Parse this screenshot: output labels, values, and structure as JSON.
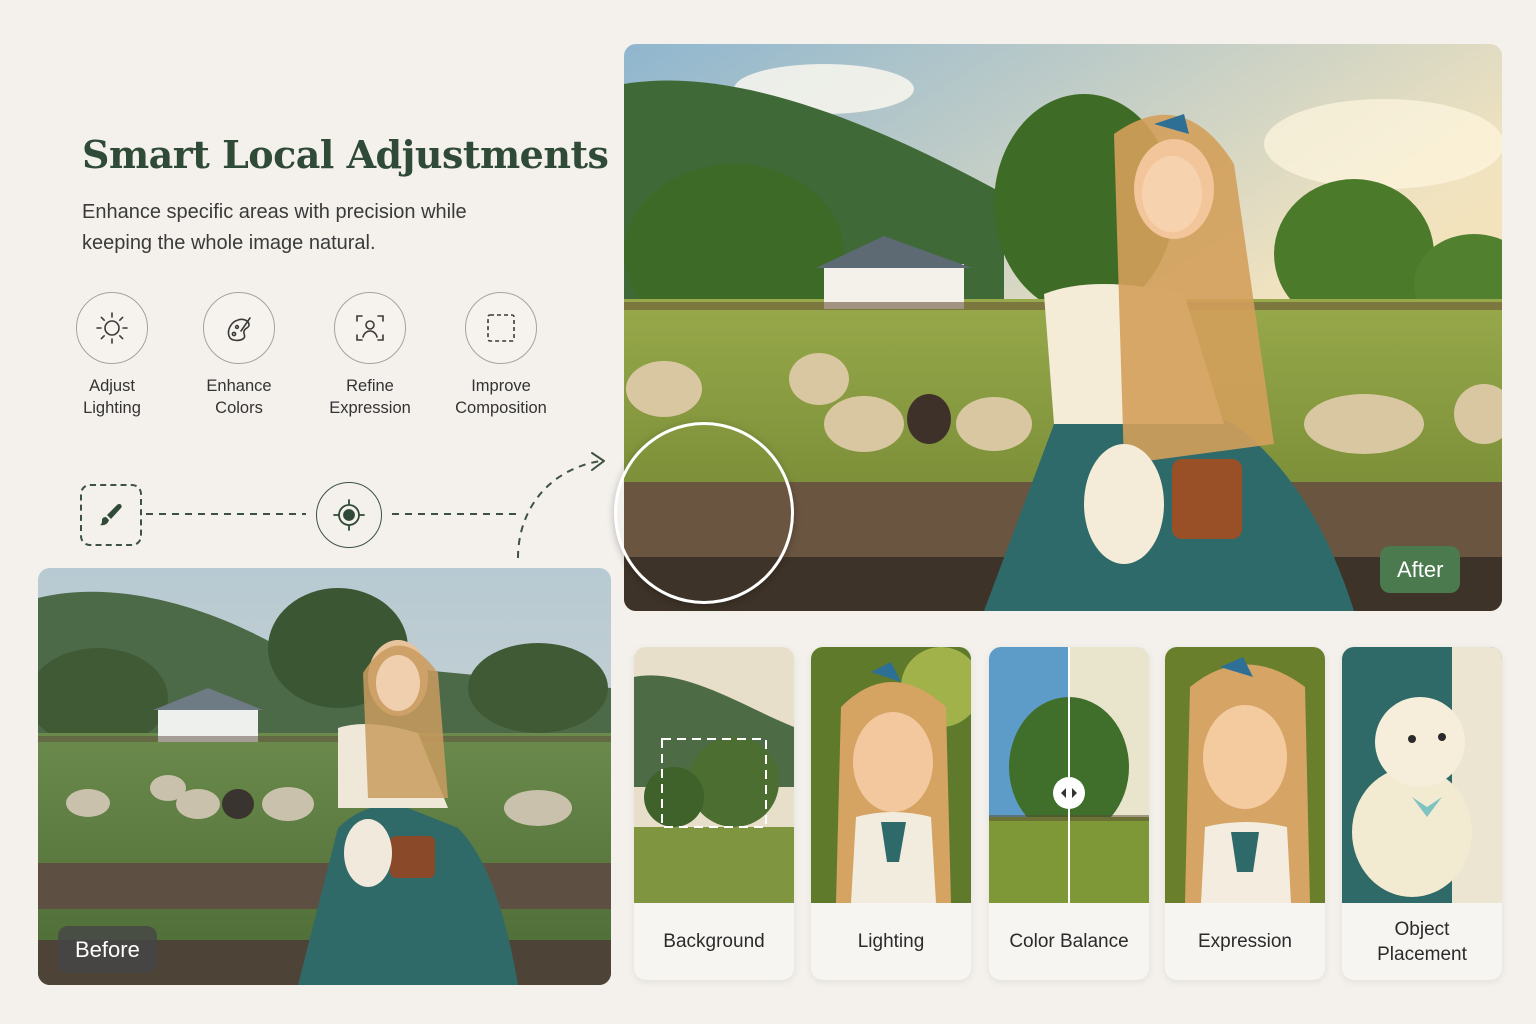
{
  "hero": {
    "title": "Smart Local Adjustments",
    "subtitle": "Enhance specific areas with precision while keeping the whole image natural."
  },
  "features": [
    {
      "line1": "Adjust",
      "line2": "Lighting",
      "icon": "sun-icon"
    },
    {
      "line1": "Enhance",
      "line2": "Colors",
      "icon": "palette-icon"
    },
    {
      "line1": "Refine",
      "line2": "Expression",
      "icon": "face-focus-icon"
    },
    {
      "line1": "Improve",
      "line2": "Composition",
      "icon": "dashed-frame-icon"
    }
  ],
  "flow": {
    "brush_icon": "brush-icon",
    "target_icon": "target-icon",
    "arrow_icon": "curved-arrow-icon"
  },
  "photos": {
    "before_label": "Before",
    "after_label": "After"
  },
  "cards": [
    {
      "line1": "Background",
      "line2": ""
    },
    {
      "line1": "Lighting",
      "line2": ""
    },
    {
      "line1": "Color Balance",
      "line2": ""
    },
    {
      "line1": "Expression",
      "line2": ""
    },
    {
      "line1": "Object",
      "line2": "Placement"
    }
  ],
  "colors": {
    "background": "#f4f1ec",
    "accent_green": "#2f4a36",
    "after_badge": "#4a7a4e",
    "before_badge": "#464646"
  }
}
